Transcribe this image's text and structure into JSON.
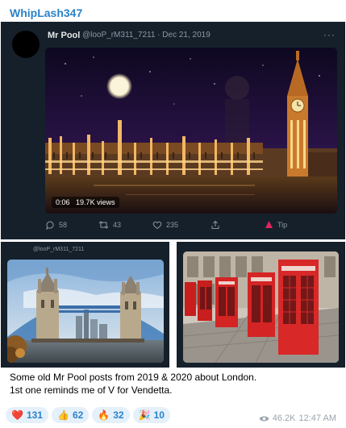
{
  "channel": {
    "name": "WhipLash347"
  },
  "tweet": {
    "author": "Mr Pool",
    "handle": "@looP_rM311_7211",
    "date": "Dec 21, 2019",
    "handle_line": "@looP_rM311_7211 · Dec 21, 2019",
    "more": "···",
    "video": {
      "duration": "0:06",
      "views": "19.7K views",
      "scene": "Palace of Westminster and Big Ben at night under a full moon"
    },
    "actions": {
      "replies": "58",
      "retweets": "43",
      "likes": "235",
      "tip": "Tip"
    }
  },
  "tiles": {
    "left": {
      "handle": "@looP_rM311_7211",
      "scene": "Tower Bridge in London under a blue sky"
    },
    "right": {
      "scene": "Row of red telephone boxes on a street"
    }
  },
  "message": {
    "line1": "Some old Mr Pool posts from 2019 & 2020 about London.",
    "line2": "1st one reminds me of V for Vendetta."
  },
  "reactions": [
    {
      "emoji": "❤️",
      "count": "131"
    },
    {
      "emoji": "👍",
      "count": "62"
    },
    {
      "emoji": "🔥",
      "count": "32"
    },
    {
      "emoji": "🎉",
      "count": "10"
    }
  ],
  "meta": {
    "views": "46.2K",
    "time": "12:47 AM"
  },
  "colors": {
    "accent": "#2a82c9",
    "tweet_bg": "#15202b",
    "reaction_bg": "#e4f0fa"
  }
}
